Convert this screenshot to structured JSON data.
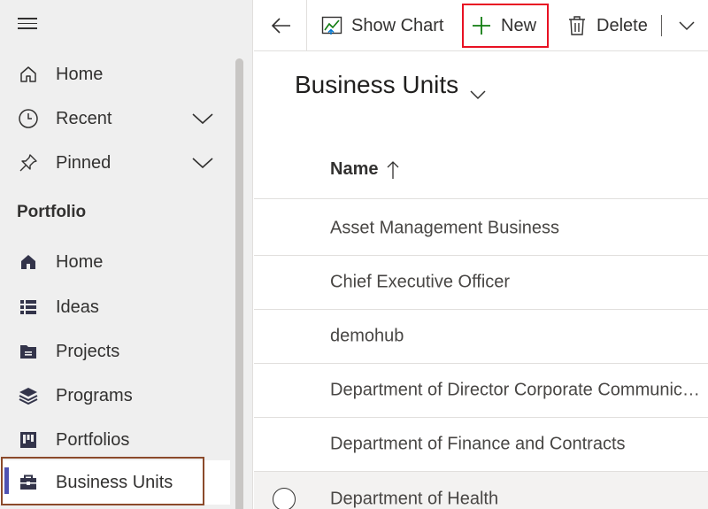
{
  "sidebar": {
    "top_items": [
      {
        "label": "Home",
        "icon": "home-outline-icon"
      },
      {
        "label": "Recent",
        "icon": "clock-icon"
      },
      {
        "label": "Pinned",
        "icon": "pin-icon"
      }
    ],
    "group_title": "Portfolio",
    "group_items": [
      {
        "label": "Home",
        "icon": "home-filled-icon"
      },
      {
        "label": "Ideas",
        "icon": "list-icon"
      },
      {
        "label": "Projects",
        "icon": "folder-icon"
      },
      {
        "label": "Programs",
        "icon": "layers-icon"
      },
      {
        "label": "Portfolios",
        "icon": "board-icon"
      },
      {
        "label": "Business Units",
        "icon": "briefcase-icon",
        "selected": true
      }
    ]
  },
  "commandbar": {
    "show_chart": "Show Chart",
    "new": "New",
    "delete": "Delete"
  },
  "view": {
    "title": "Business Units"
  },
  "grid": {
    "column_header": "Name",
    "sort": "ascending",
    "rows": [
      "Asset Management Business",
      "Chief Executive Officer",
      "demohub",
      "Department of Director Corporate Communications",
      "Department of Finance and Contracts",
      "Department of Health"
    ]
  },
  "colors": {
    "accent": "#4f52b2",
    "new_plus": "#107c10",
    "new_highlight": "#e81123",
    "selected_highlight": "#8b4a2b",
    "sidebar_icon": "#33344a"
  }
}
